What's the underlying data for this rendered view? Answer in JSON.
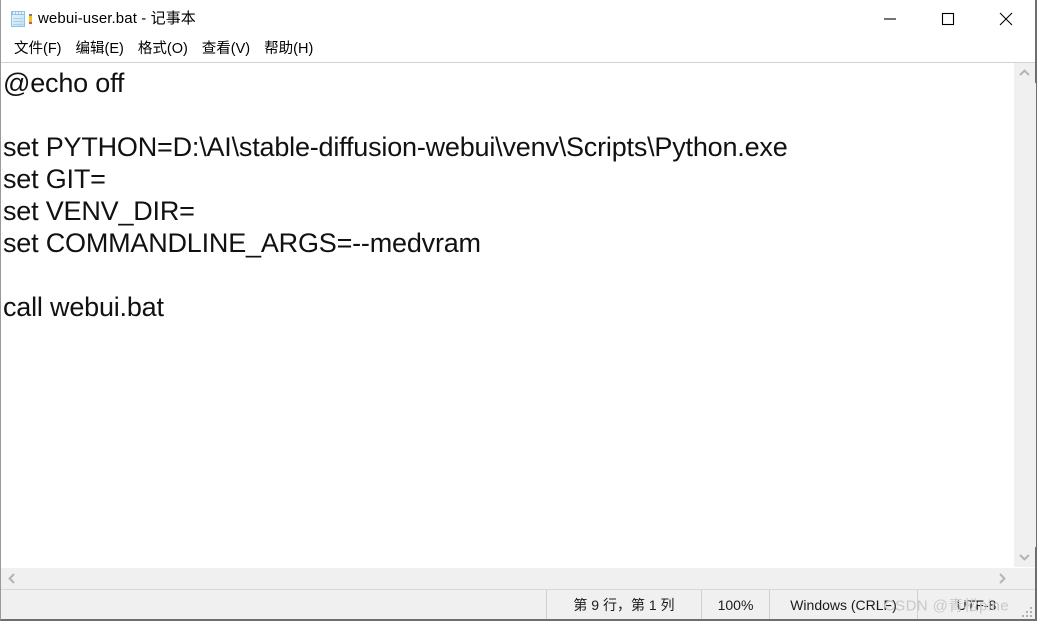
{
  "window": {
    "title": "webui-user.bat - 记事本",
    "icon": "notepad-icon",
    "caption": {
      "minimize_label": "最小化",
      "maximize_label": "最大化",
      "close_label": "关闭"
    }
  },
  "menubar": {
    "items": [
      {
        "label": "文件(F)",
        "name": "menu-file"
      },
      {
        "label": "编辑(E)",
        "name": "menu-edit"
      },
      {
        "label": "格式(O)",
        "name": "menu-format"
      },
      {
        "label": "查看(V)",
        "name": "menu-view"
      },
      {
        "label": "帮助(H)",
        "name": "menu-help"
      }
    ]
  },
  "editor": {
    "lines": [
      "@echo off",
      "",
      "set PYTHON=D:\\AI\\stable-diffusion-webui\\venv\\Scripts\\Python.exe",
      "set GIT=",
      "set VENV_DIR=",
      "set COMMANDLINE_ARGS=--medvram",
      "",
      "call webui.bat"
    ]
  },
  "statusbar": {
    "cursor_position": "第 9 行，第 1 列",
    "zoom": "100%",
    "line_ending": "Windows (CRLF)",
    "encoding": "UTF-8",
    "watermark": "CSDN @青松pine"
  },
  "scrollbars": {
    "vertical_up": "scroll-up",
    "vertical_down": "scroll-down",
    "horizontal_left": "scroll-left",
    "horizontal_right": "scroll-right"
  },
  "colors": {
    "window_bg": "#ffffff",
    "chrome_bg": "#f0f0f0",
    "text": "#111111",
    "border": "#6e6e6e",
    "watermark": "#c9c9c9"
  }
}
